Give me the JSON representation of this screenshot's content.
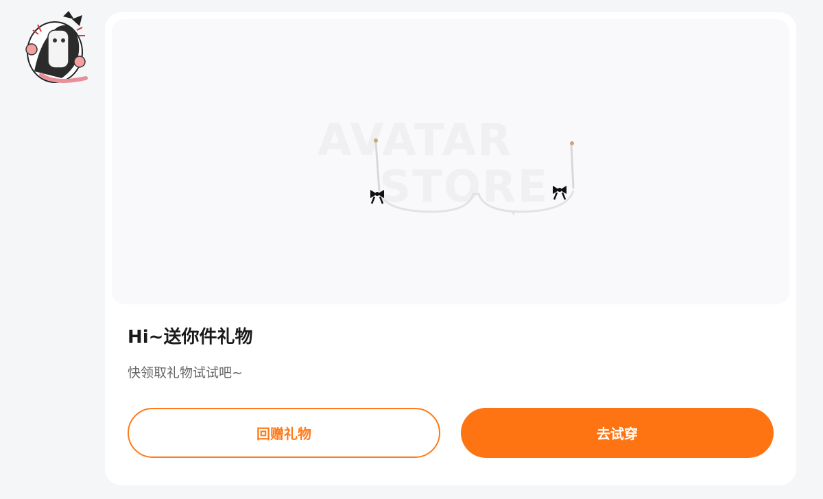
{
  "avatar": {
    "icon": "cat-girl-avatar-icon"
  },
  "card": {
    "preview": {
      "watermark_top": "AVATAR",
      "watermark_bottom": "STORE",
      "item_icon": "glasses-with-bows-icon"
    },
    "title": "Hi~送你件礼物",
    "subtitle": "快领取礼物试试吧~",
    "buttons": {
      "return_gift": "回赠礼物",
      "try_on": "去试穿"
    }
  },
  "colors": {
    "accent": "#ff7412",
    "page_bg": "#f5f6f8",
    "card_bg": "#ffffff",
    "preview_bg": "#f9f9fc"
  }
}
